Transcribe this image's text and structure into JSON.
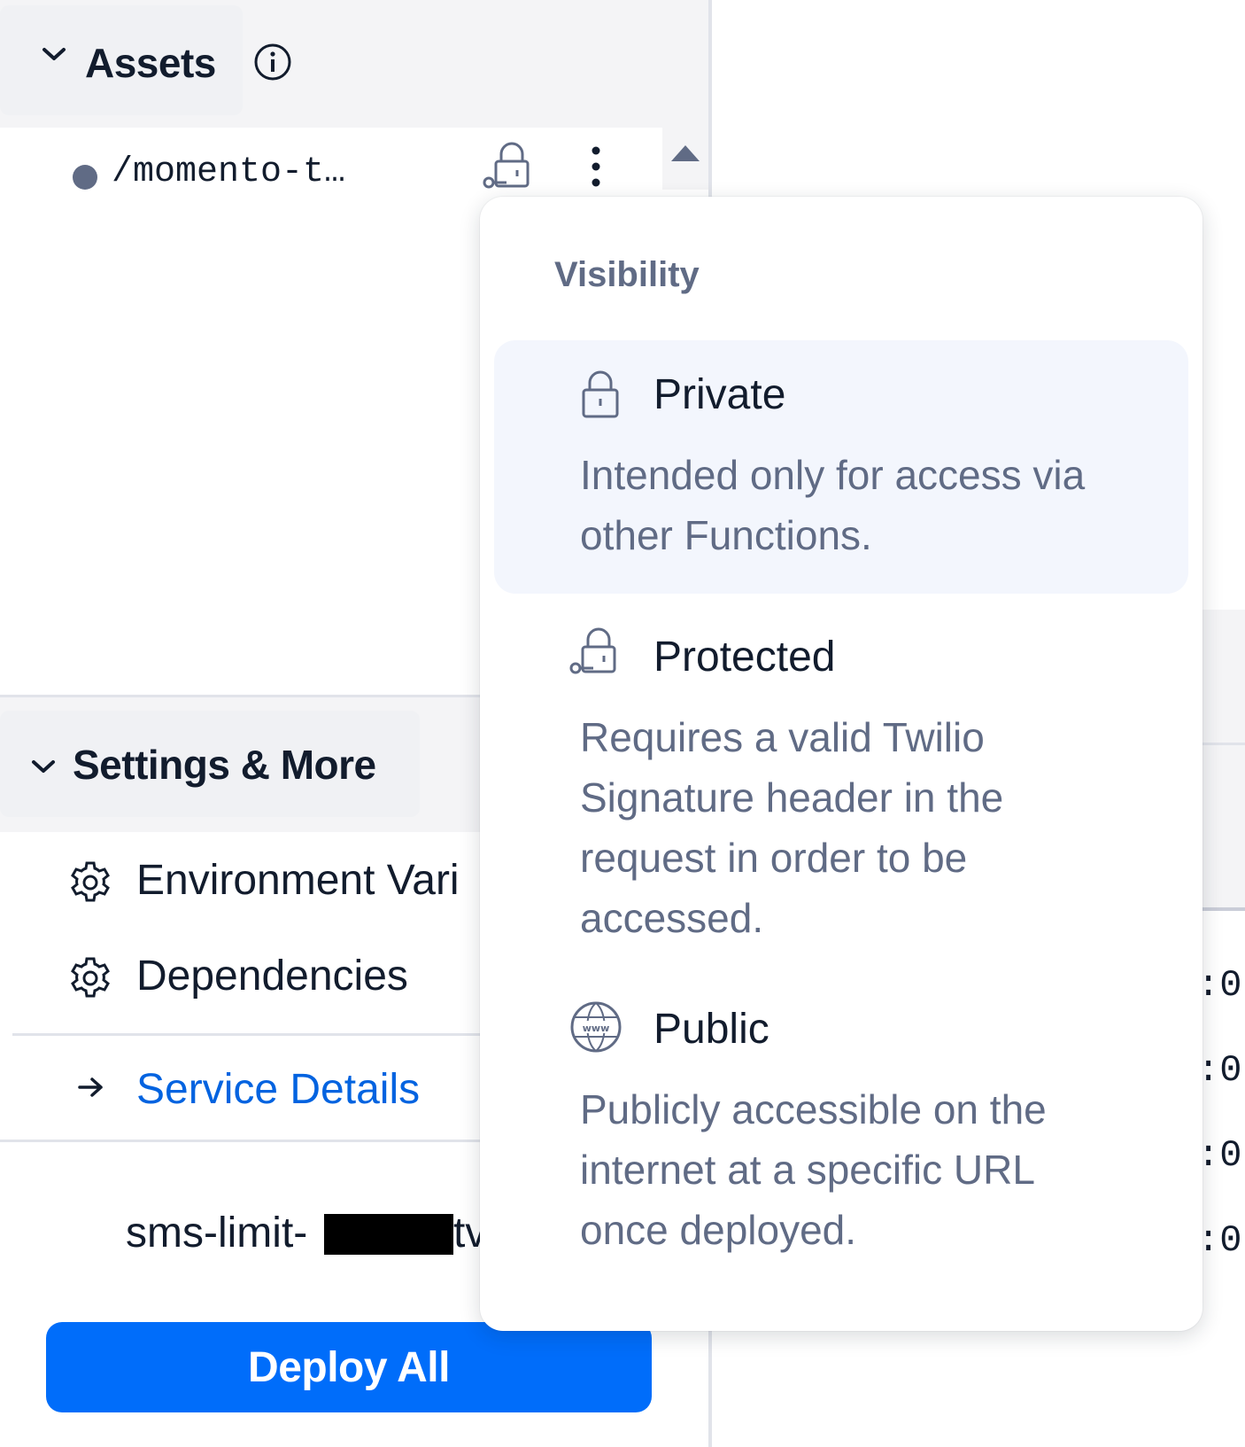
{
  "assets": {
    "title": "Assets",
    "files": [
      {
        "name": "/momento-t…",
        "visibility_icon": "protected-lock-key-icon"
      }
    ]
  },
  "settings": {
    "title": "Settings & More",
    "items": [
      {
        "label": "Environment Vari",
        "icon": "gear-icon"
      },
      {
        "label": "Dependencies",
        "icon": "gear-icon"
      }
    ],
    "service_details": "Service Details",
    "service_name_prefix": "sms-limit-",
    "service_name_suffix": "tv"
  },
  "deploy": {
    "label": "Deploy All"
  },
  "right_panel": {
    "log_fragments": [
      ":0",
      ":0",
      ":0",
      ":0"
    ]
  },
  "visibility_menu": {
    "heading": "Visibility",
    "options": [
      {
        "label": "Private",
        "description": "Intended only for access via other Functions.",
        "icon": "lock-icon",
        "selected": true
      },
      {
        "label": "Protected",
        "description": "Requires a valid Twilio Signature header in the request in order to be accessed.",
        "icon": "lock-key-icon",
        "selected": false
      },
      {
        "label": "Public",
        "description": "Publicly accessible on the internet at a specific URL once deployed.",
        "icon": "www-globe-icon",
        "selected": false
      }
    ]
  },
  "colors": {
    "accent": "#006dfa",
    "link": "#0263e0",
    "text": "#121c2d",
    "muted": "#606b85",
    "selected_bg": "#f3f6fd"
  }
}
